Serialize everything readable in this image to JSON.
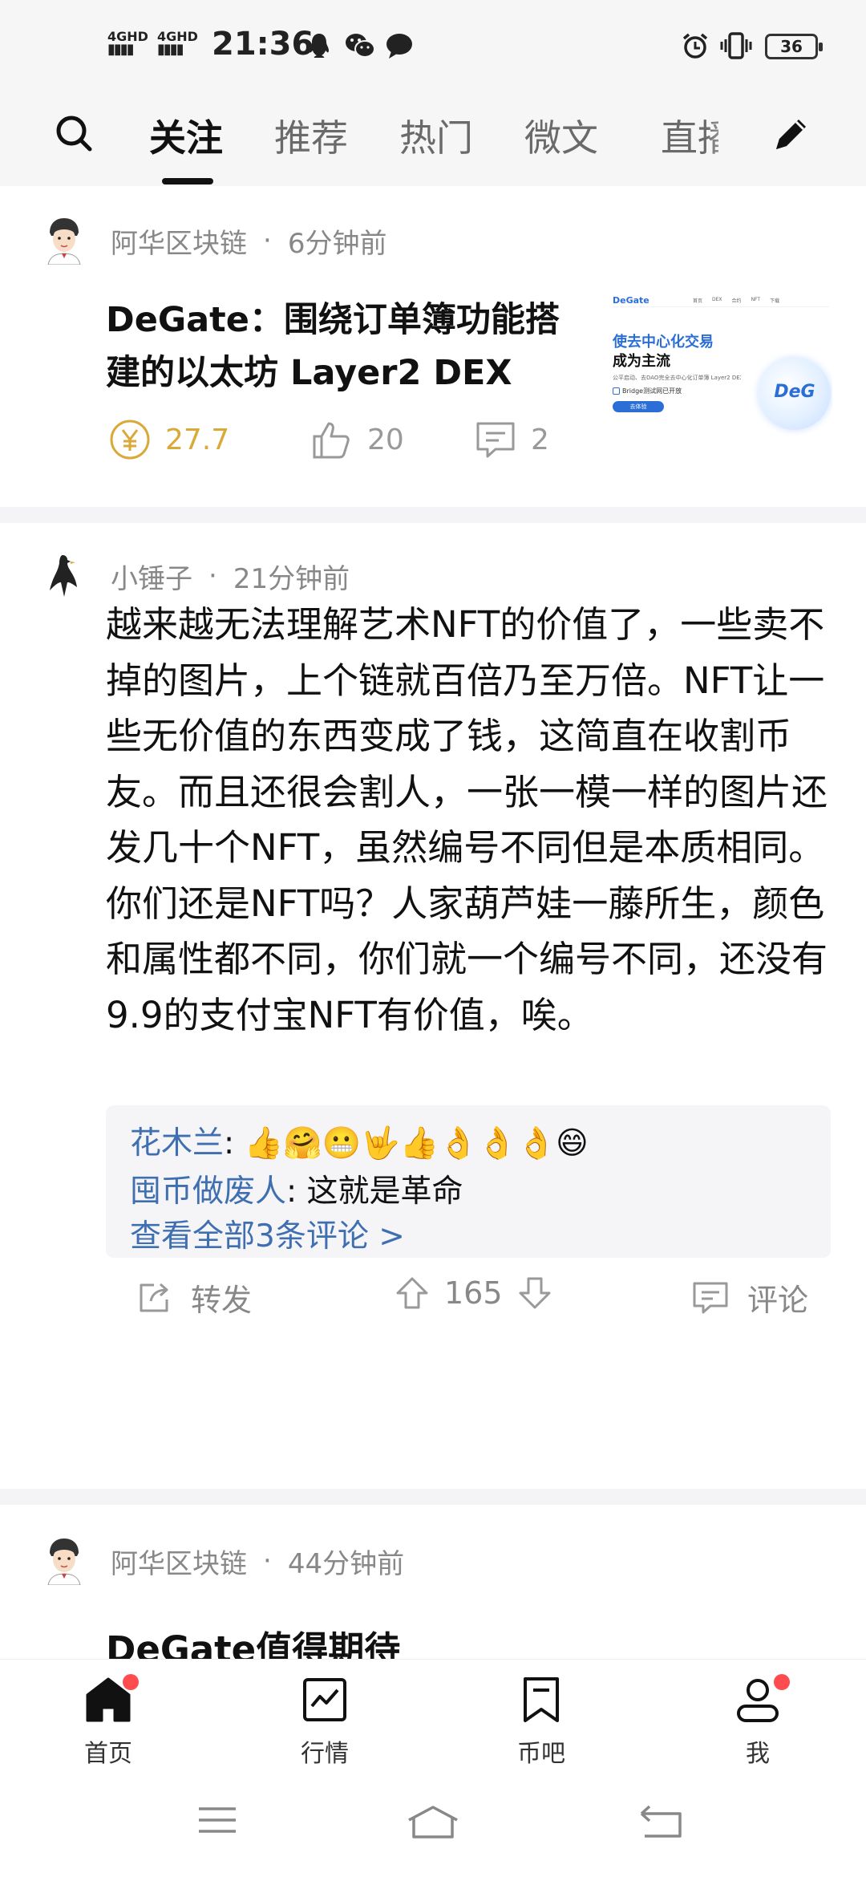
{
  "status_bar": {
    "net1_label": "4GHD",
    "net2_label": "4GHD",
    "signal": "▮▮▮▮",
    "time": "21:36",
    "battery": "36",
    "icons": [
      "qq-icon",
      "wechat-icon",
      "message-icon",
      "alarm-icon",
      "vibrate-icon",
      "battery-icon"
    ]
  },
  "top_nav": {
    "tabs": [
      {
        "label": "关注",
        "active": true
      },
      {
        "label": "推荐"
      },
      {
        "label": "热门"
      },
      {
        "label": "微文"
      },
      {
        "label": "直播"
      }
    ]
  },
  "feed": [
    {
      "author": "阿华区块链",
      "separator": "·",
      "time": "6分钟前",
      "title": "DeGate：围绕订单簿功能搭建的以太坊 Layer2 DEX",
      "thumbnail": {
        "brand": "DeGate",
        "nav": [
          "首页",
          "DEX",
          "合约",
          "NFT",
          "下载"
        ],
        "headline1": "使去中心化交易",
        "headline2": "成为主流",
        "sub": "公平启动、去DAO完全去中心化订单簿 Layer2 DEX",
        "bridge": "Bridge测试网已开放",
        "button": "去体验",
        "logo": "DeG"
      },
      "reward": "27.7",
      "likes": "20",
      "comments": "2"
    },
    {
      "author": "小锤子",
      "separator": "·",
      "time": "21分钟前",
      "body": "越来越无法理解艺术NFT的价值了，一些卖不掉的图片，上个链就百倍乃至万倍。NFT让一些无价值的东西变成了钱，这简直在收割币友。而且还很会割人，一张一模一样的图片还发几十个NFT，虽然编号不同但是本质相同。你们还是NFT吗？人家葫芦娃一藤所生，颜色和属性都不同，你们就一个编号不同，还没有9.9的支付宝NFT有价值，唉。",
      "comments": [
        {
          "name": "花木兰",
          "text": ": 👍🤗😬🤟👍👌👌👌😄"
        },
        {
          "name": "囤币做废人",
          "text": ": 这就是革命"
        }
      ],
      "view_all": "查看全部3条评论 >",
      "forward_label": "转发",
      "vote_count": "165",
      "comment_label": "评论"
    },
    {
      "author": "阿华区块链",
      "separator": "·",
      "time": "44分钟前",
      "title": "DeGate值得期待"
    }
  ],
  "bottom_nav": [
    {
      "label": "首页",
      "active": true,
      "badge": true
    },
    {
      "label": "行情"
    },
    {
      "label": "币吧"
    },
    {
      "label": "我",
      "badge": true
    }
  ],
  "colors": {
    "accent_blue": "#3f6fb0",
    "reward_gold": "#d9a93a",
    "badge_red": "#ff4d4f"
  }
}
